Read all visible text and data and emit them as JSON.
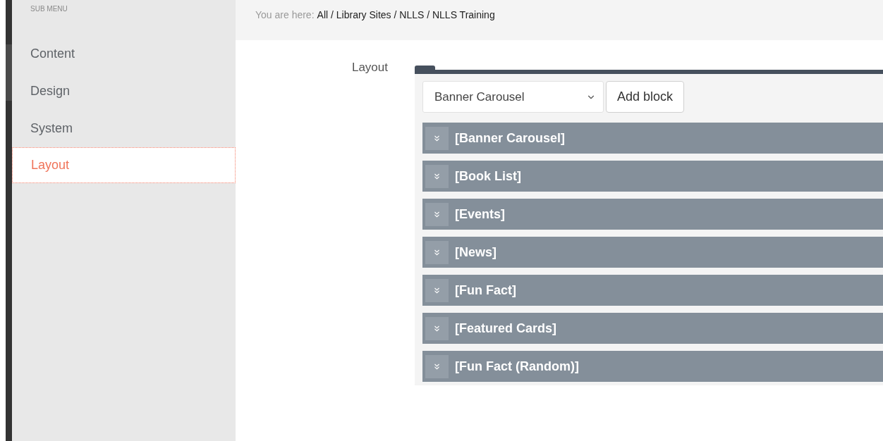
{
  "sidebar": {
    "heading": "SUB MENU",
    "items": [
      {
        "label": "Content",
        "selected": false
      },
      {
        "label": "Design",
        "selected": false
      },
      {
        "label": "System",
        "selected": false
      },
      {
        "label": "Layout",
        "selected": true
      }
    ]
  },
  "breadcrumb": {
    "label": "You are here:",
    "path": "All / Library Sites / NLLS / NLLS Training"
  },
  "form": {
    "label": "Layout",
    "select": {
      "value": "Banner Carousel"
    },
    "add_button": "Add block",
    "blocks": [
      {
        "title": "[Banner Carousel]"
      },
      {
        "title": "[Book List]"
      },
      {
        "title": "[Events]"
      },
      {
        "title": "[News]"
      },
      {
        "title": "[Fun Fact]"
      },
      {
        "title": "[Featured Cards]"
      },
      {
        "title": "[Fun Fact (Random)]"
      }
    ]
  }
}
